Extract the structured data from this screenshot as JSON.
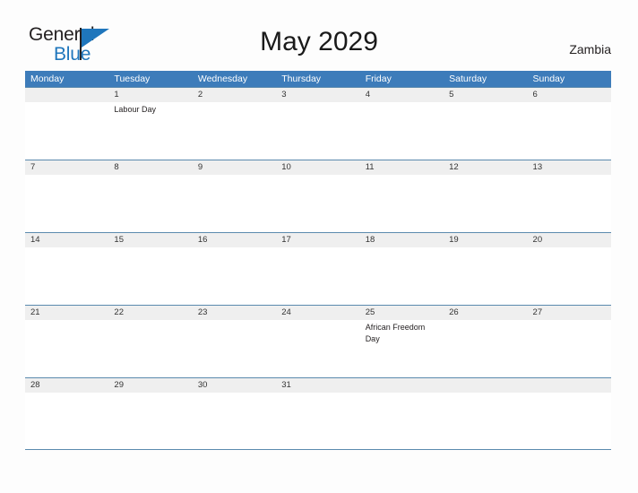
{
  "brand": {
    "name_part1": "General",
    "name_part2": "Blue",
    "flag_icon": "flag-triangle-icon"
  },
  "header": {
    "title": "May 2029",
    "country": "Zambia"
  },
  "calendar": {
    "weekdays": [
      "Monday",
      "Tuesday",
      "Wednesday",
      "Thursday",
      "Friday",
      "Saturday",
      "Sunday"
    ],
    "colors": {
      "header_blue": "#3d7cba",
      "date_band_gray": "#efefef",
      "rule_blue": "#5b8aae",
      "brand_blue": "#1f76bc",
      "text_dark": "#231f20"
    },
    "weeks": [
      {
        "days": [
          {
            "number": "",
            "event": ""
          },
          {
            "number": "1",
            "event": "Labour Day"
          },
          {
            "number": "2",
            "event": ""
          },
          {
            "number": "3",
            "event": ""
          },
          {
            "number": "4",
            "event": ""
          },
          {
            "number": "5",
            "event": ""
          },
          {
            "number": "6",
            "event": ""
          }
        ]
      },
      {
        "days": [
          {
            "number": "7",
            "event": ""
          },
          {
            "number": "8",
            "event": ""
          },
          {
            "number": "9",
            "event": ""
          },
          {
            "number": "10",
            "event": ""
          },
          {
            "number": "11",
            "event": ""
          },
          {
            "number": "12",
            "event": ""
          },
          {
            "number": "13",
            "event": ""
          }
        ]
      },
      {
        "days": [
          {
            "number": "14",
            "event": ""
          },
          {
            "number": "15",
            "event": ""
          },
          {
            "number": "16",
            "event": ""
          },
          {
            "number": "17",
            "event": ""
          },
          {
            "number": "18",
            "event": ""
          },
          {
            "number": "19",
            "event": ""
          },
          {
            "number": "20",
            "event": ""
          }
        ]
      },
      {
        "days": [
          {
            "number": "21",
            "event": ""
          },
          {
            "number": "22",
            "event": ""
          },
          {
            "number": "23",
            "event": ""
          },
          {
            "number": "24",
            "event": ""
          },
          {
            "number": "25",
            "event": "African Freedom Day"
          },
          {
            "number": "26",
            "event": ""
          },
          {
            "number": "27",
            "event": ""
          }
        ]
      },
      {
        "days": [
          {
            "number": "28",
            "event": ""
          },
          {
            "number": "29",
            "event": ""
          },
          {
            "number": "30",
            "event": ""
          },
          {
            "number": "31",
            "event": ""
          },
          {
            "number": "",
            "event": ""
          },
          {
            "number": "",
            "event": ""
          },
          {
            "number": "",
            "event": ""
          }
        ]
      }
    ]
  }
}
